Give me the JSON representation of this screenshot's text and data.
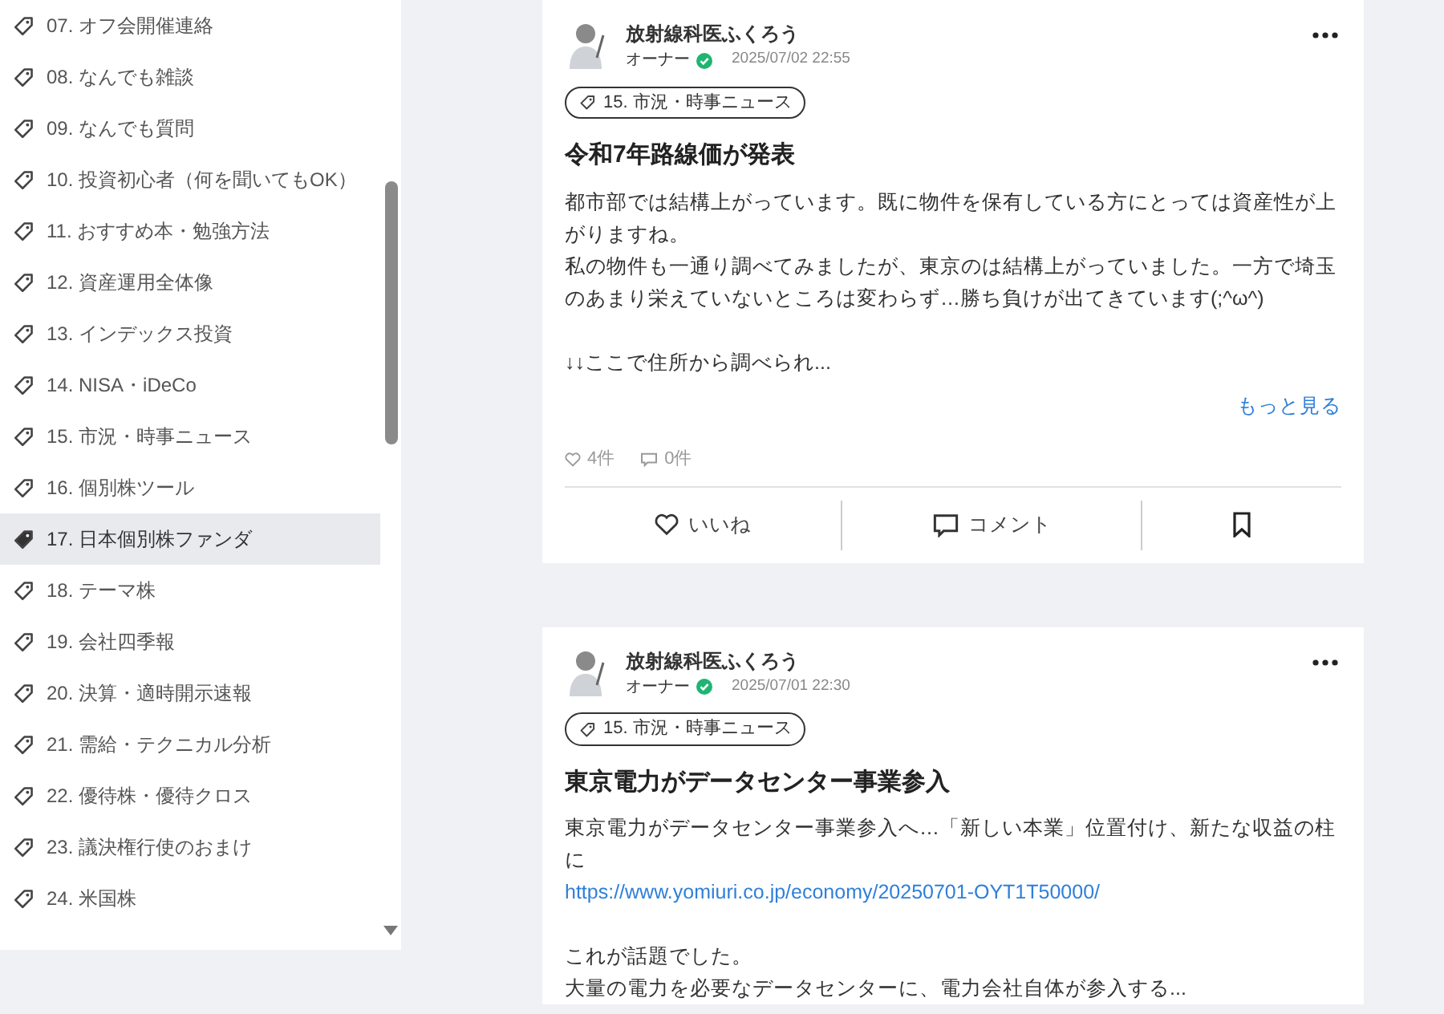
{
  "sidebar": {
    "items": [
      {
        "label": "07. オフ会開催連絡",
        "selected": false
      },
      {
        "label": "08. なんでも雑談",
        "selected": false
      },
      {
        "label": "09. なんでも質問",
        "selected": false
      },
      {
        "label": "10. 投資初心者（何を聞いてもOK）",
        "selected": false
      },
      {
        "label": "11. おすすめ本・勉強方法",
        "selected": false
      },
      {
        "label": "12. 資産運用全体像",
        "selected": false
      },
      {
        "label": "13. インデックス投資",
        "selected": false
      },
      {
        "label": "14. NISA・iDeCo",
        "selected": false
      },
      {
        "label": "15. 市況・時事ニュース",
        "selected": false
      },
      {
        "label": "16. 個別株ツール",
        "selected": false
      },
      {
        "label": "17. 日本個別株ファンダ",
        "selected": true
      },
      {
        "label": "18. テーマ株",
        "selected": false
      },
      {
        "label": "19. 会社四季報",
        "selected": false
      },
      {
        "label": "20. 決算・適時開示速報",
        "selected": false
      },
      {
        "label": "21. 需給・テクニカル分析",
        "selected": false
      },
      {
        "label": "22. 優待株・優待クロス",
        "selected": false
      },
      {
        "label": "23. 議決権行使のおまけ",
        "selected": false
      },
      {
        "label": "24. 米国株",
        "selected": false
      }
    ]
  },
  "posts": [
    {
      "author": "放射線科医ふくろう",
      "role": "オーナー",
      "verified": true,
      "time": "2025/07/02 22:55",
      "tag": "15. 市況・時事ニュース",
      "title": "令和7年路線価が発表",
      "body": [
        {
          "kind": "text",
          "spaced": false,
          "text": "都市部では結構上がっています。既に物件を保有している方にとっては資産性が上がりますね。"
        },
        {
          "kind": "text",
          "spaced": false,
          "text": "私の物件も一通り調べてみましたが、東京のは結構上がっていました。一方で埼玉のあまり栄えていないところは変わらず…勝ち負けが出てきています(;^ω^)"
        },
        {
          "kind": "text",
          "spaced": true,
          "text": "↓↓ここで住所から調べられ..."
        }
      ],
      "more": "もっと見る",
      "likes": "4件",
      "comments": "0件",
      "actions": {
        "like": "いいね",
        "comment": "コメント"
      }
    },
    {
      "author": "放射線科医ふくろう",
      "role": "オーナー",
      "verified": true,
      "time": "2025/07/01 22:30",
      "tag": "15. 市況・時事ニュース",
      "title": "東京電力がデータセンター事業参入",
      "body": [
        {
          "kind": "text",
          "spaced": false,
          "text": "東京電力がデータセンター事業参入へ…「新しい本業」位置付け、新たな収益の柱に"
        },
        {
          "kind": "link",
          "spaced": false,
          "text": "https://www.yomiuri.co.jp/economy/20250701-OYT1T50000/"
        },
        {
          "kind": "text",
          "spaced": true,
          "text": "これが話題でした。"
        },
        {
          "kind": "text",
          "spaced": false,
          "text": "大量の電力を必要なデータセンターに、電力会社自体が参入する..."
        }
      ]
    }
  ]
}
